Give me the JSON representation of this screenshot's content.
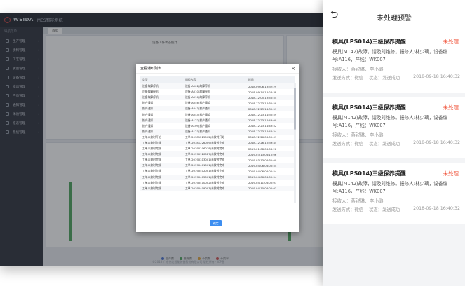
{
  "desktop": {
    "logo": "WEIDA",
    "system_name": "MES智能系统",
    "nav_title": "导航菜单",
    "menu": [
      "生产管理",
      "质料管理",
      "工艺管理",
      "质量管理",
      "设备管理",
      "模具管理",
      "产品管理",
      "通知管理",
      "体验管理",
      "报表管理",
      "系统管理"
    ],
    "tab": "首页",
    "panel_title": "设备工作状态统计",
    "footer": "©2018 广东伟达智能装备股份有限公司 版权所有 · ICP备",
    "legend": [
      {
        "label": "生产数",
        "color": "#4a6fd0"
      },
      {
        "label": "合格数",
        "color": "#4aa35a"
      },
      {
        "label": "不良数",
        "color": "#e0a33b"
      },
      {
        "label": "不良率",
        "color": "#d05050"
      }
    ],
    "modal": {
      "title": "查看通知列表",
      "columns": [
        "类型",
        "通知内容",
        "时间"
      ],
      "rows": [
        [
          "设备故障停机",
          "设备(A001)故障停机",
          "2018-09-06 13:32:29"
        ],
        [
          "设备故障停机",
          "设备(A010)故障停机",
          "2018-09-14 16:28:38"
        ],
        [
          "设备故障停机",
          "设备(A016)故障停机",
          "2018-12-05 13:55:54"
        ],
        [
          "换产通知",
          "设备(A046)换产通知",
          "2018-12-23 14:30:59"
        ],
        [
          "换产通知",
          "设备(A043)换产通知",
          "2018-12-23 14:30:59"
        ],
        [
          "换产通知",
          "设备(A044)换产通知",
          "2018-12-23 14:30:59"
        ],
        [
          "换产通知",
          "设备(A122)换产通知",
          "2018-12-23 14:43:00"
        ],
        [
          "换产通知",
          "设备(A109)换产通知",
          "2018-12-23 14:43:52"
        ],
        [
          "换产通知",
          "设备(A123)换产通知",
          "2018-12-23 14:46:24"
        ],
        [
          "工单未按时开始",
          "工单(20181225002)未按时开始",
          "2018-12-26 08:00:01"
        ],
        [
          "工单未按时完成",
          "工单(20181226009)未按时完成",
          "2018-12-26 10:39:45"
        ],
        [
          "工单未按时完成",
          "工单(20190106018)未按时完成",
          "2019-01-08 08:08:28"
        ],
        [
          "工单未按时完成",
          "工单(20190120027)未按时完成",
          "2019-03-13 08:10:06"
        ],
        [
          "工单未按时完成",
          "工单(20190313001)未按时完成",
          "2019-03-13 08:35:00"
        ],
        [
          "工单未按时完成",
          "工单(20190401001)未按时完成",
          "2019-04-06 08:00:54"
        ],
        [
          "工单未按时完成",
          "工单(20190402001)未按时完成",
          "2019-04-06 08:00:54"
        ],
        [
          "工单未按时完成",
          "工单(20190405001)未按时完成",
          "2019-04-06 08:00:54"
        ],
        [
          "工单未按时完成",
          "工单(20190410002)未按时完成",
          "2019-04-11 08:00:03"
        ],
        [
          "工单未按时完成",
          "工单(20190409003)未按时完成",
          "2019-04-10 08:00:03"
        ]
      ],
      "ok_label": "确定"
    }
  },
  "mobile": {
    "title": "未处理预警",
    "cards": [
      {
        "title": "模具(LPS014)三级保养提醒",
        "status": "未处理",
        "desc": "模具(M142)故障，请及时维修。报修人:林少璃，设备编号:A116，产线：WK007",
        "receivers": "接收人：蒋锐琳、李小璐",
        "send_method": "发送方式：微信",
        "send_state": "状态：发送成功",
        "time": "2018-09-18 16:40:32"
      },
      {
        "title": "模具(LPS014)三级保养提醒",
        "status": "未处理",
        "desc": "模具(M142)故障，请及时维修。报修人:林少璃，设备编号:A116，产线：WK007",
        "receivers": "接收人：蒋锐琳、李小璐",
        "send_method": "发送方式：微信",
        "send_state": "状态：发送成功",
        "time": "2018-09-18 16:40:32"
      },
      {
        "title": "模具(LPS014)三级保养提醒",
        "status": "未处理",
        "desc": "模具(M142)故障，请及时维修。报修人:林少璃，设备编号:A116，产线：WK007",
        "receivers": "接收人：蒋锐琳、李小璐",
        "send_method": "发送方式：微信",
        "send_state": "状态：发送成功",
        "time": "2018-09-18 16:40:32"
      }
    ]
  }
}
